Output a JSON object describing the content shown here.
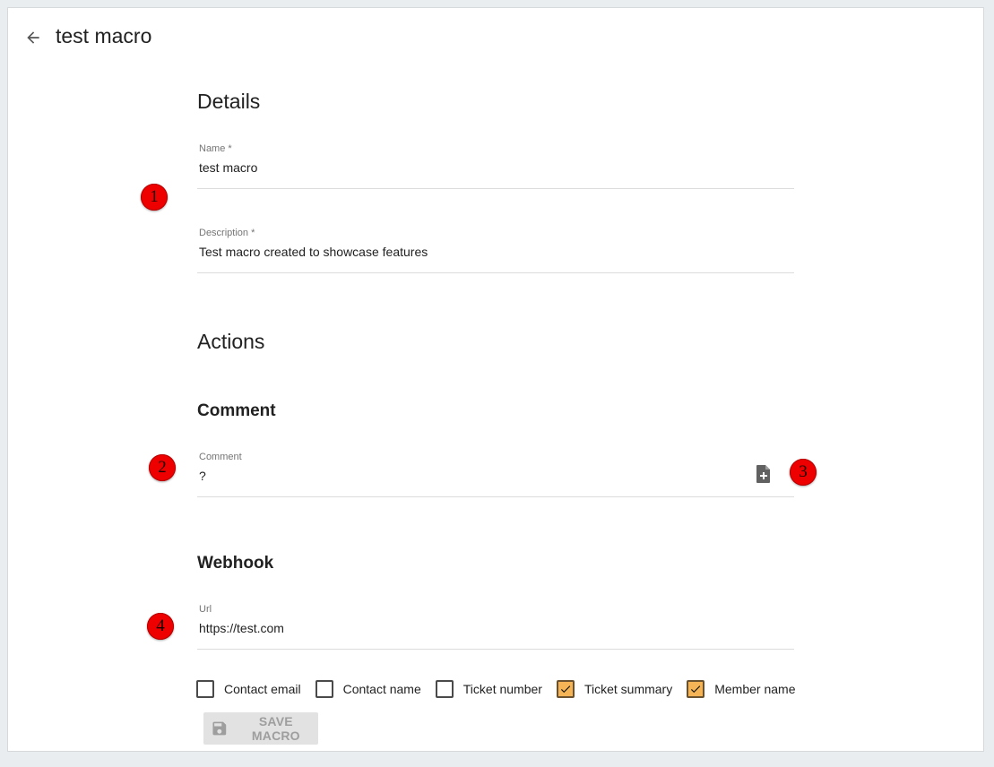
{
  "header": {
    "title": "test macro"
  },
  "details": {
    "heading": "Details",
    "name": {
      "label": "Name *",
      "value": "test macro"
    },
    "description": {
      "label": "Description *",
      "value": "Test macro created to showcase features"
    }
  },
  "actions": {
    "heading": "Actions",
    "comment": {
      "heading": "Comment",
      "label": "Comment",
      "value": "?",
      "attach_icon": "add-document-icon"
    },
    "webhook": {
      "heading": "Webhook",
      "url_label": "Url",
      "url_value": "https://test.com",
      "options": [
        {
          "label": "Contact email",
          "checked": false
        },
        {
          "label": "Contact name",
          "checked": false
        },
        {
          "label": "Ticket number",
          "checked": false
        },
        {
          "label": "Ticket summary",
          "checked": true
        },
        {
          "label": "Member name",
          "checked": true
        }
      ]
    }
  },
  "save_button": {
    "label": "SAVE MACRO",
    "icon": "floppy-disk-icon"
  },
  "annotations": [
    "1",
    "2",
    "3",
    "4"
  ],
  "colors": {
    "accent_checkbox": "#f5b456",
    "badge": "#ef0000",
    "page_bg": "#e9edf0"
  }
}
